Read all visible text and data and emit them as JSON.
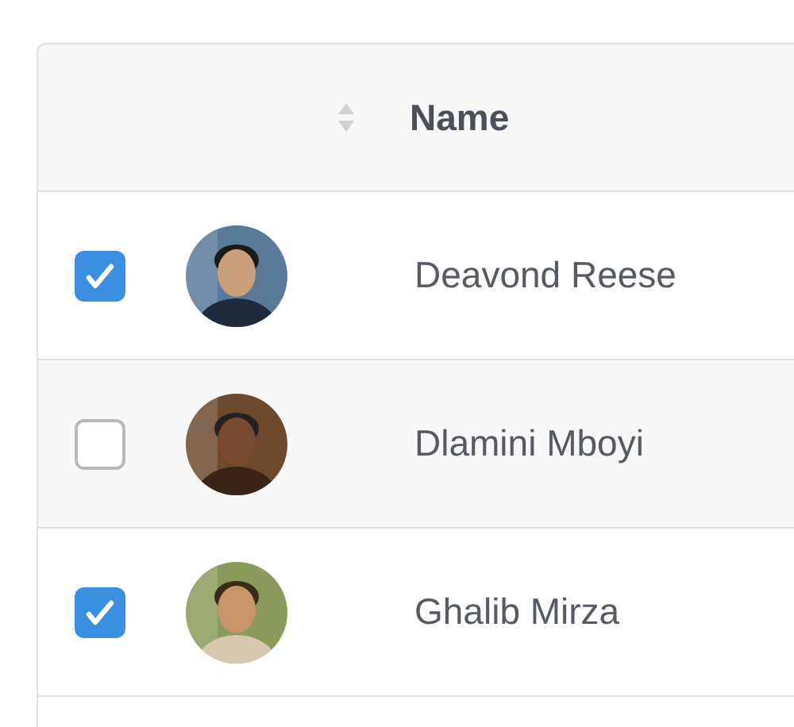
{
  "table": {
    "columns": [
      {
        "label": "Name",
        "sortable": true
      }
    ],
    "rows": [
      {
        "name": "Deavond Reese",
        "checked": true
      },
      {
        "name": "Dlamini Mboyi",
        "checked": false
      },
      {
        "name": "Ghalib Mirza",
        "checked": true
      }
    ]
  }
}
